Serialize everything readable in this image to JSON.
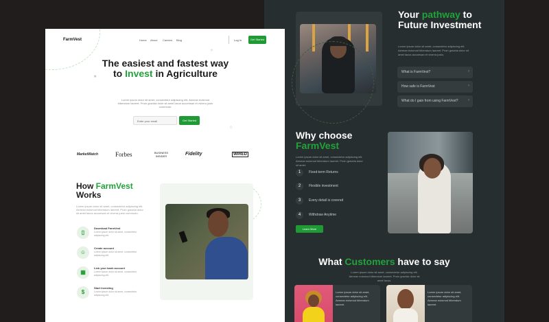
{
  "colors": {
    "accent": "#1f9a34",
    "dark_bg": "#272e2f",
    "page_bg": "#221d1d"
  },
  "white_page": {
    "logo": "FarmVest",
    "nav": [
      "Home",
      "About",
      "Careers",
      "Blog",
      "Contact"
    ],
    "login": "Log In",
    "get_started": "Get Started",
    "hero_title": {
      "pre": "The easiest and fastest way to ",
      "accent": "Invest",
      "post": " in Agriculture"
    },
    "hero_sub": "Lorem ipsum dolor sit amet, consectetur adipiscing elit. Aenean euismod bibendum laoreet. Proin gravida dolor sit amet lacus accumsan et viverra justo commodo.",
    "email_placeholder": "Enter your email",
    "email_button": "Get Started",
    "brands": [
      "MarketWatch",
      "Forbes",
      "BUSINESS INSIDER",
      "Fidelity",
      "WIRED"
    ],
    "how_title": {
      "pre": "How ",
      "accent": "FarmVest",
      "post": " Works"
    },
    "how_text": "Lorem ipsum dolor sit amet, consectetur adipiscing elit. Aenean euismod bibendum laoreet. Proin gravida dolor sit amet lacus accumsan et viverra justo commodo.",
    "steps": [
      {
        "icon": "phone-icon",
        "glyph": "▯",
        "title": "Download FarmVest",
        "desc": "Lorem ipsum dolor sit amet, consectetur adipiscing elit."
      },
      {
        "icon": "user-icon",
        "glyph": "☺",
        "title": "Create account",
        "desc": "Lorem ipsum dolor sit amet, consectetur adipiscing elit."
      },
      {
        "icon": "bank-icon",
        "glyph": "▦",
        "title": "Link your bank account",
        "desc": "Lorem ipsum dolor sit amet, consectetur adipiscing elit."
      },
      {
        "icon": "dollar-icon",
        "glyph": "$",
        "title": "Start Investing",
        "desc": "Lorem ipsum dolor sit amet, consectetur adipiscing elit."
      }
    ]
  },
  "dark_page": {
    "path_title": {
      "pre": "Your ",
      "accent": "pathway",
      "post": " to Future Investment"
    },
    "path_text": "Lorem ipsum dolor sit amet, consectetur adipiscing elit. Aenean euismod bibendum laoreet. Proin gravida dolor sit amet lacus accumsan et viverra justo.",
    "faqs": [
      "What is FarmVest?",
      "How safe is FarmVest",
      "What do I gain from using FarmVest?"
    ],
    "why_title": {
      "pre": "Why choose ",
      "accent": "FarmVest",
      "post": ""
    },
    "why_text": "Lorem ipsum dolor sit amet, consectetur adipiscing elit. Aenean euismod bibendum laoreet. Proin gravida dolor sit amet.",
    "why_steps": [
      "Fixed-term Returns",
      "Flexible investment",
      "Every detail is covered",
      "Withdraw Anytime"
    ],
    "why_button": "Learn More",
    "customers_title": {
      "pre": "What ",
      "accent": "Customers",
      "post": " have to say"
    },
    "customers_text": "Lorem ipsum dolor sit amet, consectetur adipiscing elit. Aenean euismod bibendum laoreet. Proin gravida dolor sit amet lacus.",
    "testimonials": [
      "Lorem ipsum dolor sit amet, consectetur adipiscing elit. Aenean euismod bibendum laoreet.",
      "Lorem ipsum dolor sit amet, consectetur adipiscing elit. Aenean euismod bibendum laoreet."
    ]
  }
}
